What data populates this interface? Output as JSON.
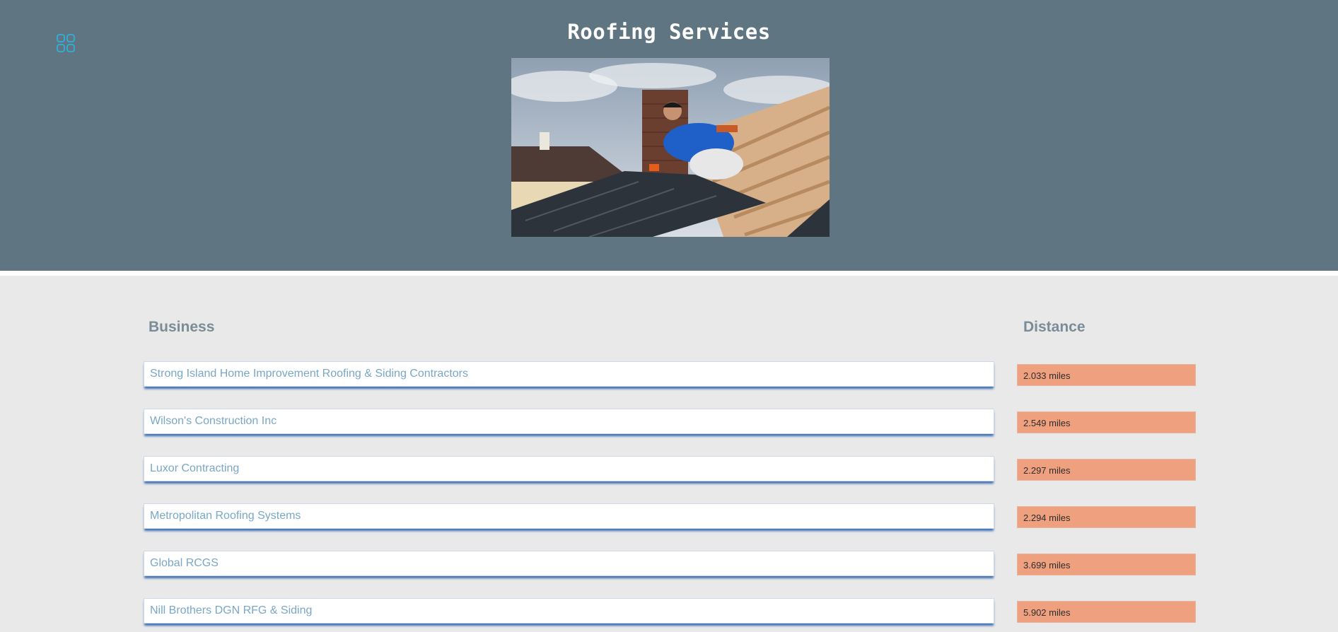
{
  "header": {
    "title": "Roofing Services",
    "menu_icon": "grid-menu-icon",
    "hero_image": "roofer-installing-metal-roof-tiles-photo"
  },
  "table": {
    "columns": [
      "Business",
      "Distance"
    ],
    "rows": [
      {
        "business": "Strong Island Home Improvement Roofing & Siding Contractors",
        "distance": "2.033 miles"
      },
      {
        "business": "Wilson's Construction Inc",
        "distance": "2.549 miles"
      },
      {
        "business": "Luxor Contracting",
        "distance": "2.297 miles"
      },
      {
        "business": "Metropolitan Roofing Systems",
        "distance": "2.294 miles"
      },
      {
        "business": "Global RCGS",
        "distance": "3.699 miles"
      },
      {
        "business": "Nill Brothers DGN RFG & Siding",
        "distance": "5.902 miles"
      }
    ]
  },
  "colors": {
    "header_bg": "#5f7582",
    "page_bg": "#e9e9e9",
    "business_text": "#79a7c6",
    "distance_bg": "#efa07e",
    "icon_accent": "#2bb6e6"
  }
}
